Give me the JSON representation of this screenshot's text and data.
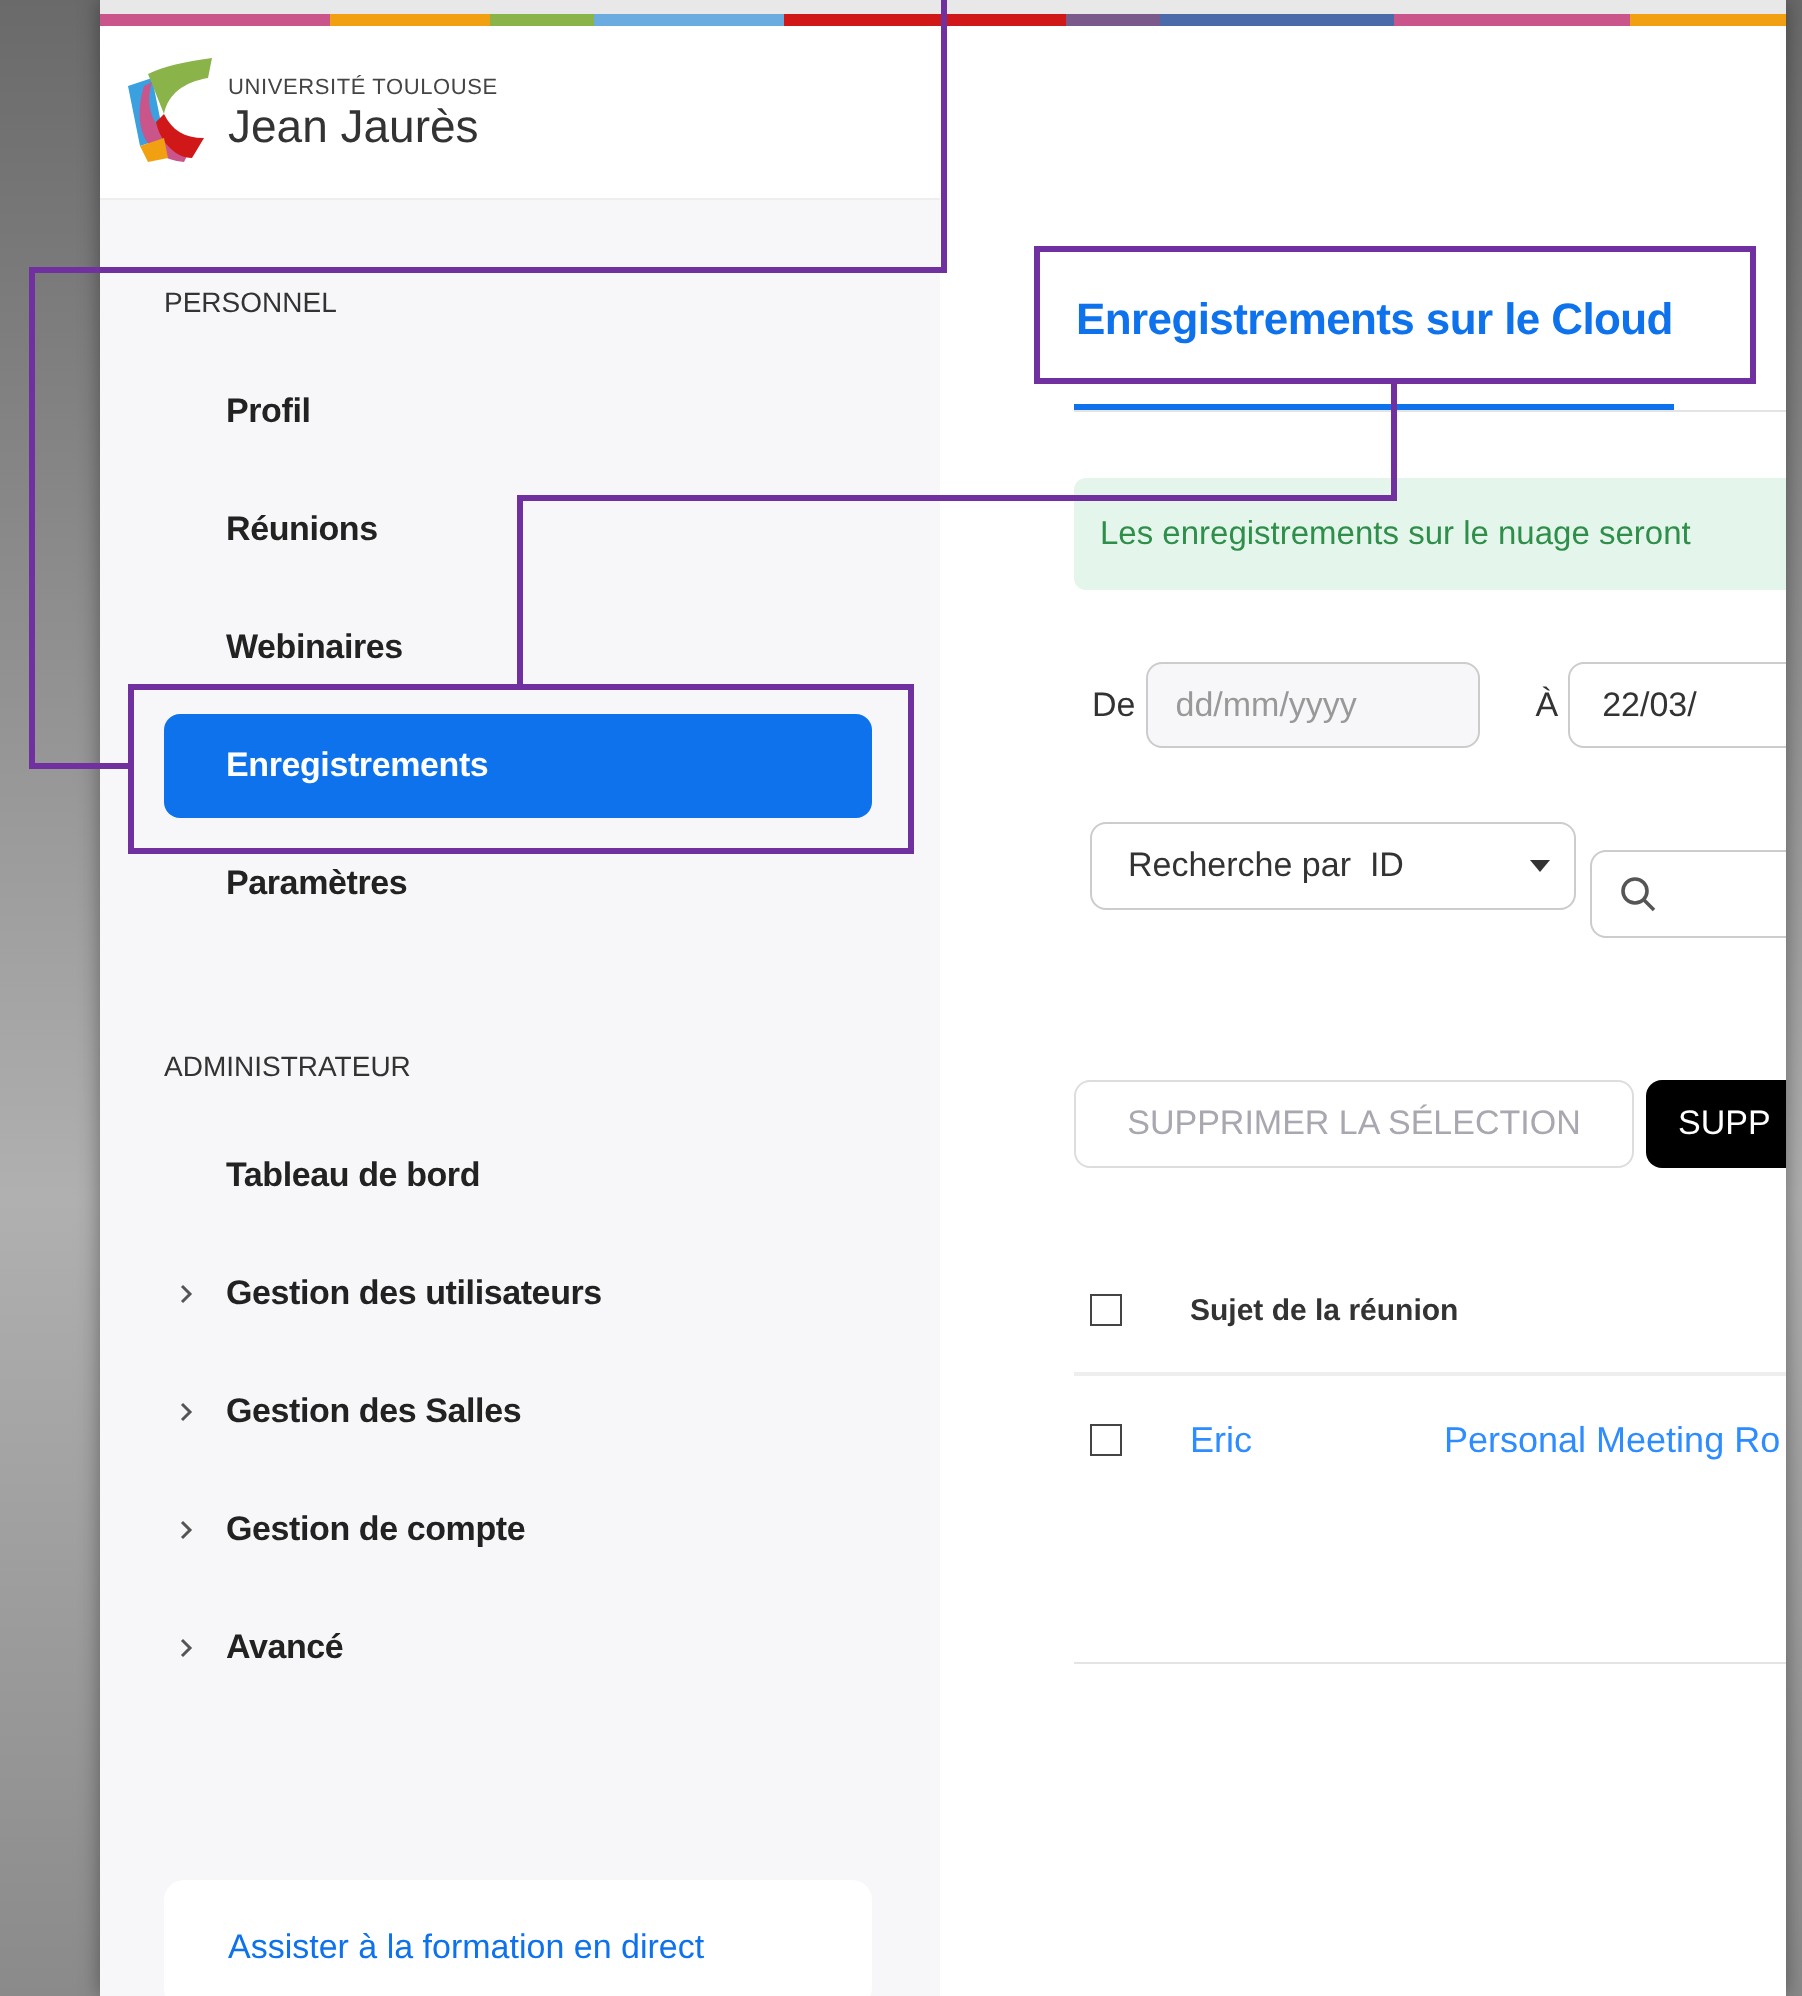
{
  "header": {
    "logo": {
      "line_1": "UNIVERSITÉ TOULOUSE",
      "line_2": "Jean Jaurès"
    }
  },
  "sidebar": {
    "sections": [
      {
        "heading": "PERSONNEL",
        "items": [
          {
            "label": "Profil",
            "selected": false,
            "expandable": false
          },
          {
            "label": "Réunions",
            "selected": false,
            "expandable": false
          },
          {
            "label": "Webinaires",
            "selected": false,
            "expandable": false
          },
          {
            "label": "Enregistrements",
            "selected": true,
            "expandable": false
          },
          {
            "label": "Paramètres",
            "selected": false,
            "expandable": false
          }
        ]
      },
      {
        "heading": "ADMINISTRATEUR",
        "items": [
          {
            "label": "Tableau de bord",
            "selected": false,
            "expandable": false
          },
          {
            "label": "Gestion des utilisateurs",
            "selected": false,
            "expandable": true
          },
          {
            "label": "Gestion des Salles",
            "selected": false,
            "expandable": true
          },
          {
            "label": "Gestion de compte",
            "selected": false,
            "expandable": true
          },
          {
            "label": "Avancé",
            "selected": false,
            "expandable": true
          }
        ]
      }
    ],
    "help_card": {
      "link": "Assister à la formation en direct"
    }
  },
  "tabs": [
    {
      "label": "Enregistrements sur le Cloud",
      "selected": true
    }
  ],
  "notice": "Les enregistrements sur le nuage seront",
  "date_filter": {
    "from_label": "De",
    "from_placeholder": "dd/mm/yyyy",
    "to_label": "À",
    "to_value": "22/03/"
  },
  "search": {
    "type_select": "Recherche par  ID"
  },
  "buttons": [
    {
      "label": "SUPPRIMER LA SÉLECTION",
      "disabled": true
    },
    {
      "label": "SUPP",
      "disabled": false
    }
  ],
  "table": {
    "header_checked": false,
    "columns": [
      "Sujet de la réunion"
    ],
    "rows": [
      {
        "checked": false,
        "cells": [
          "Eric",
          "Personal Meeting Ro"
        ]
      }
    ]
  }
}
